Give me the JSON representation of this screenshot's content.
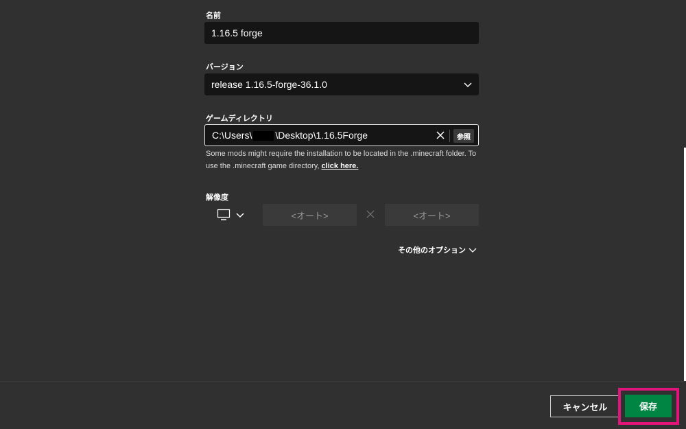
{
  "form": {
    "name": {
      "label": "名前",
      "value": "1.16.5 forge"
    },
    "version": {
      "label": "バージョン",
      "value": "release 1.16.5-forge-36.1.0"
    },
    "game_directory": {
      "label": "ゲームディレクトリ",
      "value_prefix": "C:\\Users\\",
      "value_suffix": "\\Desktop\\1.16.5Forge",
      "browse_label": "参照",
      "help_text": "Some mods might require the installation to be located in the .minecraft folder. To use the .minecraft game directory,",
      "help_link": "click here."
    },
    "resolution": {
      "label": "解像度",
      "width_placeholder": "<オート>",
      "height_placeholder": "<オート>"
    },
    "more_options_label": "その他のオプション"
  },
  "footer": {
    "cancel_label": "キャンセル",
    "save_label": "保存"
  },
  "colors": {
    "background": "#303030",
    "input_bg": "#151515",
    "save_green": "#008542",
    "highlight": "#e0147a"
  }
}
